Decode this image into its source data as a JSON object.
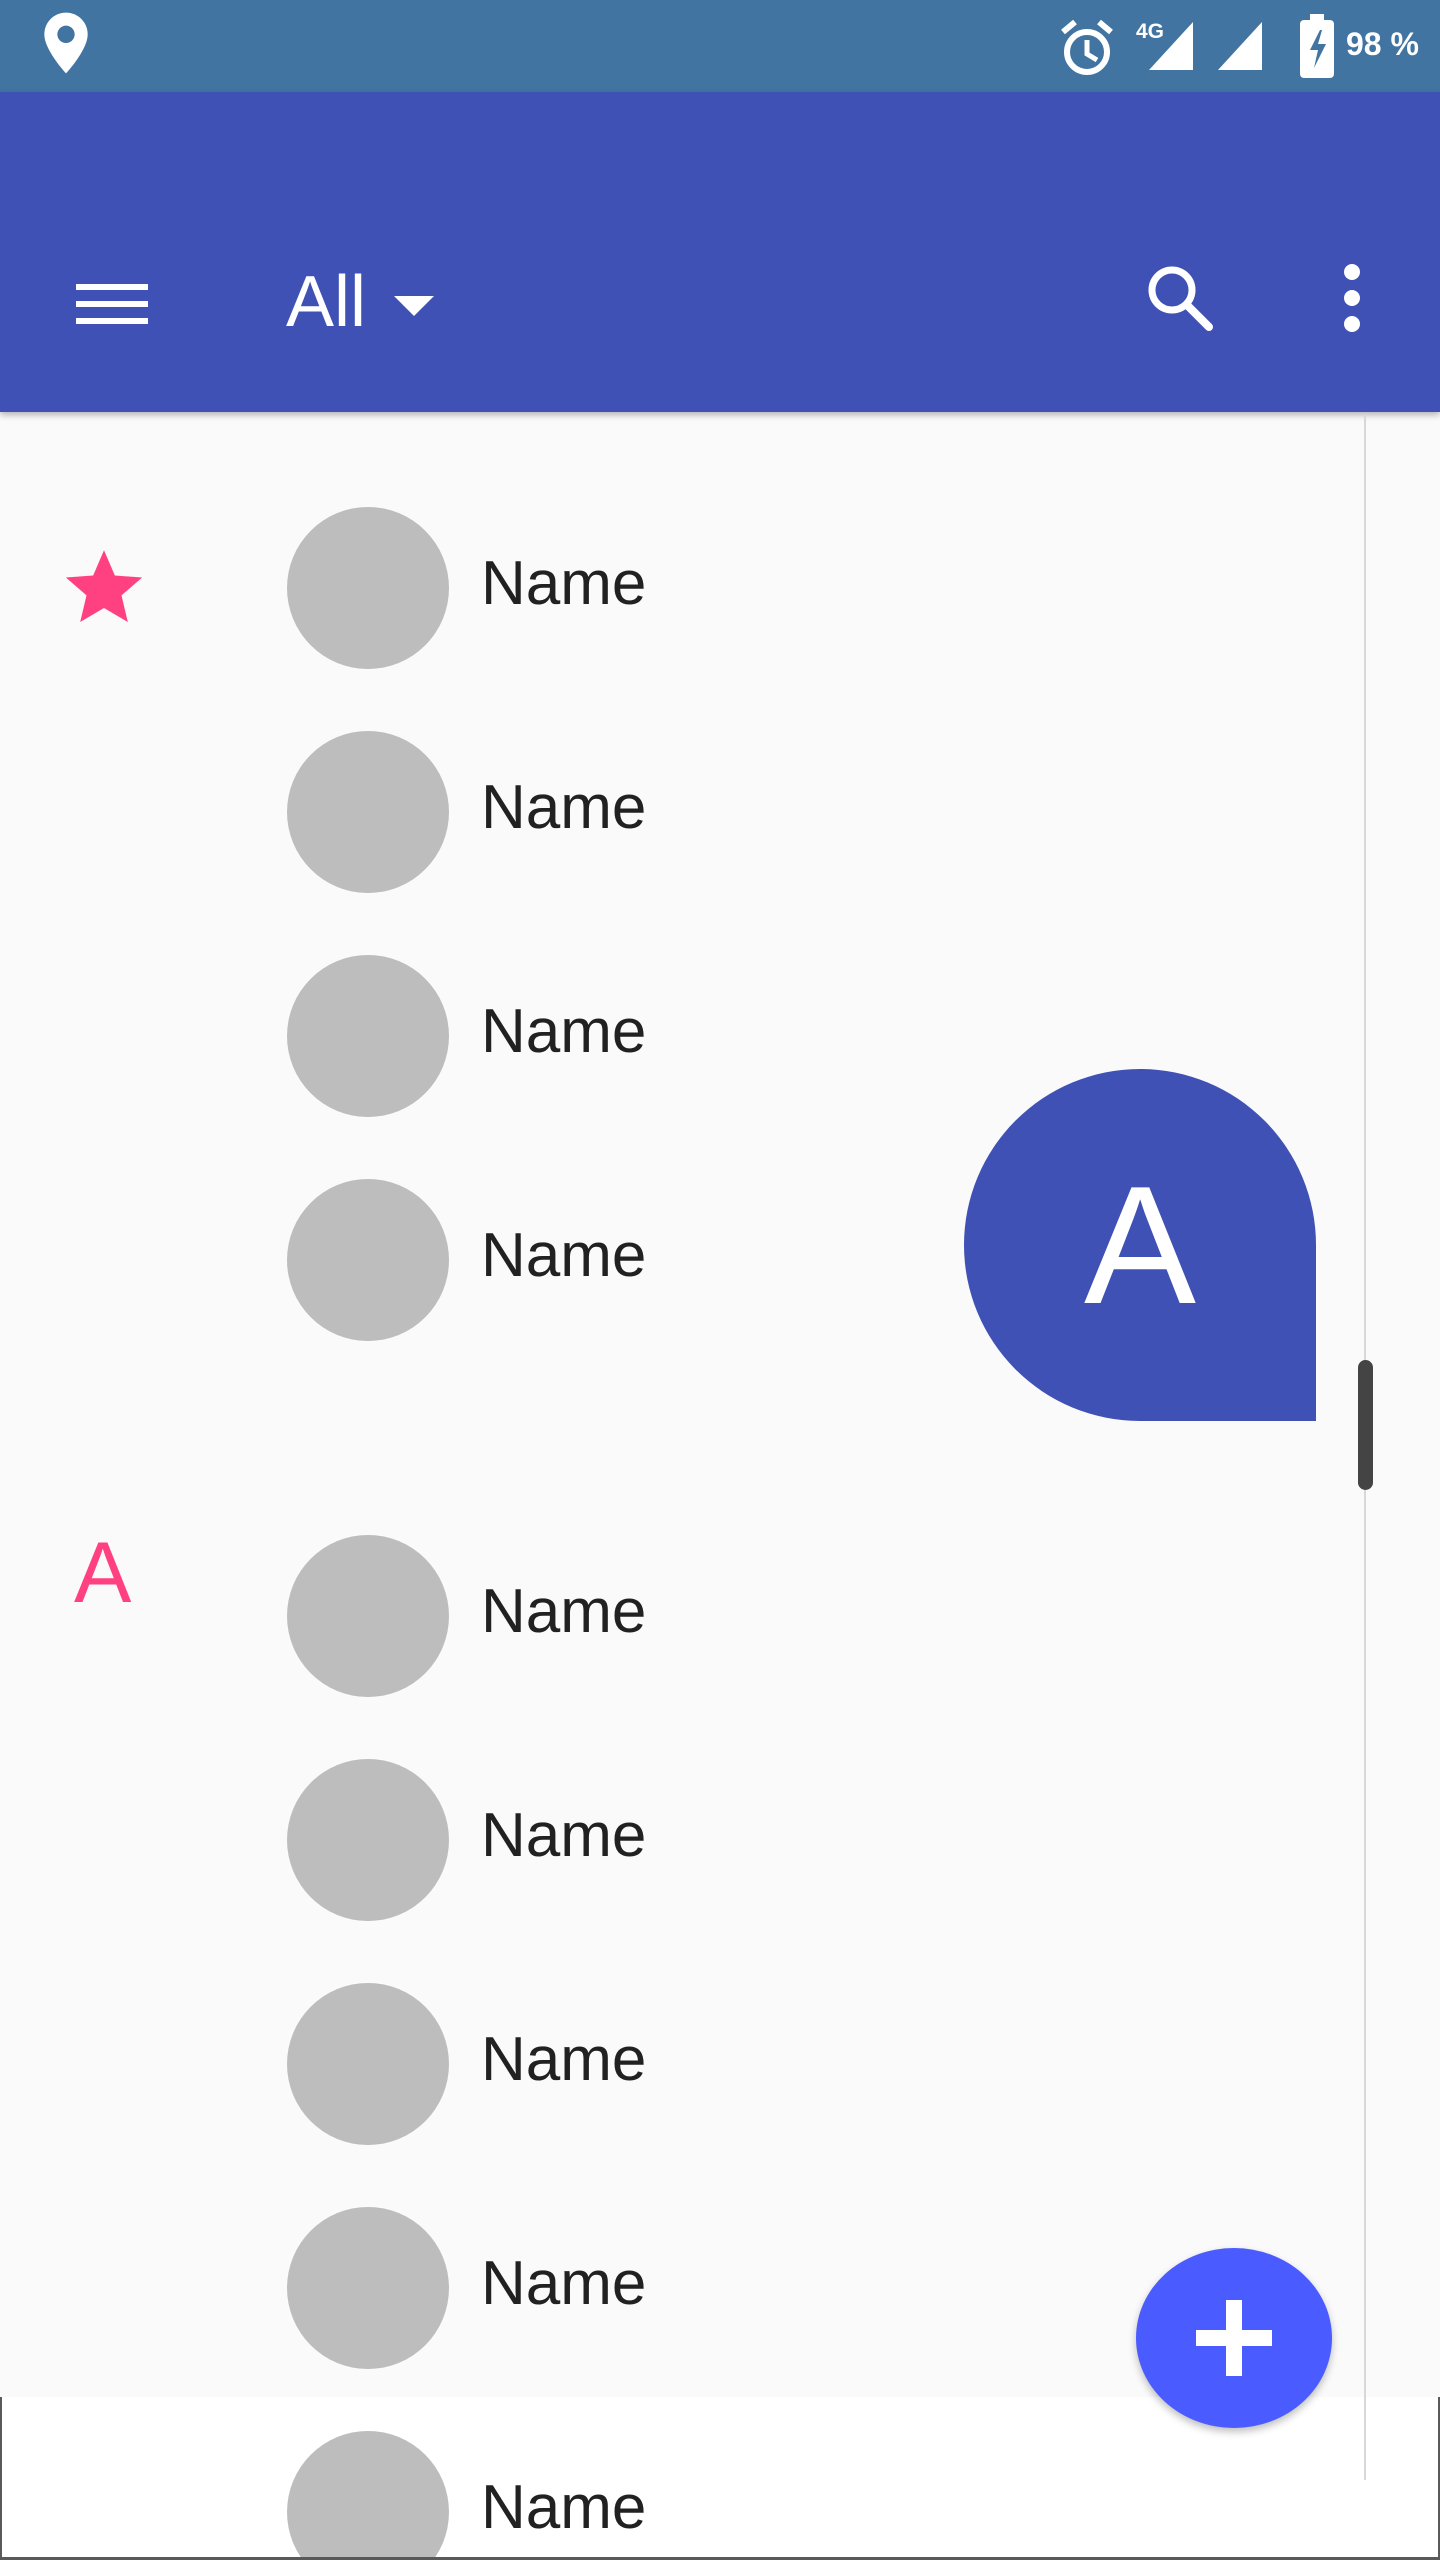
{
  "status_bar": {
    "network": "4G",
    "battery": "98 %",
    "icons": [
      "location-pin-icon",
      "alarm-icon",
      "signal-icon",
      "signal-icon",
      "battery-charging-icon"
    ]
  },
  "toolbar": {
    "filter_label": "All",
    "icons": [
      "menu-icon",
      "caret-down-icon",
      "search-icon",
      "more-vert-icon"
    ]
  },
  "sections": {
    "favorites_icon": "star-icon",
    "letter": "A"
  },
  "contacts": [
    {
      "name": "Name"
    },
    {
      "name": "Name"
    },
    {
      "name": "Name"
    },
    {
      "name": "Name"
    },
    {
      "name": "Name"
    },
    {
      "name": "Name"
    },
    {
      "name": "Name"
    },
    {
      "name": "Name"
    },
    {
      "name": "Name"
    }
  ],
  "fast_scroll": {
    "bubble_letter": "A"
  },
  "fab": {
    "icon": "plus-icon"
  },
  "colors": {
    "status_bar": "#4174a1",
    "toolbar": "#3f51b5",
    "accent": "#ff4081",
    "fab": "#4a5cff",
    "avatar": "#bdbdbd",
    "background": "#fafafa"
  }
}
